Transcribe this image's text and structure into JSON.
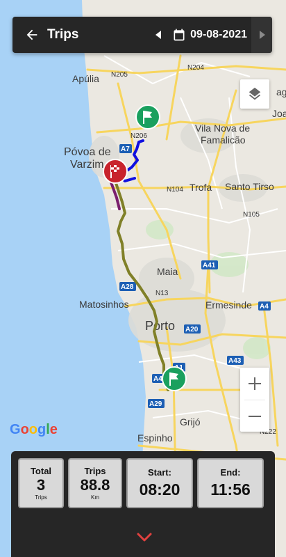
{
  "header": {
    "title": "Trips",
    "date": "09-08-2021"
  },
  "map": {
    "places": {
      "apulia": "Apúlia",
      "povoa_1": "Póvoa de",
      "povoa_2": "Varzim",
      "vila_nova_1": "Vila Nova de",
      "vila_nova_2": "Famalicão",
      "trofa": "Trofa",
      "santo_tirso": "Santo Tirso",
      "maia": "Maia",
      "ermesinde": "Ermesinde",
      "matosinhos": "Matosinhos",
      "porto": "Porto",
      "grijo": "Grijó",
      "espinho": "Espinho",
      "joa": "Joa",
      "ag": "ag"
    },
    "roads": {
      "n205": "N205",
      "n204": "N204",
      "n206": "N206",
      "n104": "N104",
      "n105": "N105",
      "n13": "N13",
      "n222": "N222"
    },
    "shields": {
      "a7": "A7",
      "a41": "A41",
      "a28": "A28",
      "a20": "A20",
      "a4": "A4",
      "a43": "A43",
      "a1": "A1",
      "a4b": "A4",
      "a29": "A29"
    },
    "colors": {
      "sea": "#a8d1f5",
      "land": "#eae7df",
      "route_blue": "#1010e0",
      "route_olive": "#808020",
      "start_flag": "#1aa05e",
      "end_flag": "#c8232c"
    }
  },
  "google_logo": "Google",
  "stats": {
    "total": {
      "label": "Total",
      "value": "3",
      "unit": "Trips"
    },
    "trips": {
      "label": "Trips",
      "value": "88.8",
      "unit": "Km"
    },
    "start": {
      "label": "Start:",
      "value": "08:20"
    },
    "end": {
      "label": "End:",
      "value": "11:56"
    }
  }
}
